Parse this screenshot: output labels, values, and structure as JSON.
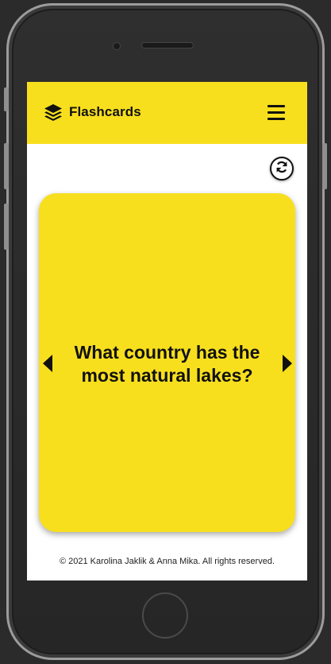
{
  "header": {
    "title": "Flashcards",
    "accent_color": "#f8df1e",
    "logo_icon": "layer-group-icon",
    "menu_icon": "hamburger-menu-icon"
  },
  "toolbar": {
    "flip_icon": "refresh-icon"
  },
  "card": {
    "question": "What country has the most natural lakes?",
    "prev_icon": "caret-left-icon",
    "next_icon": "caret-right-icon"
  },
  "footer": {
    "copyright": "© 2021 Karolina Jaklik & Anna Mika. All rights reserved."
  }
}
